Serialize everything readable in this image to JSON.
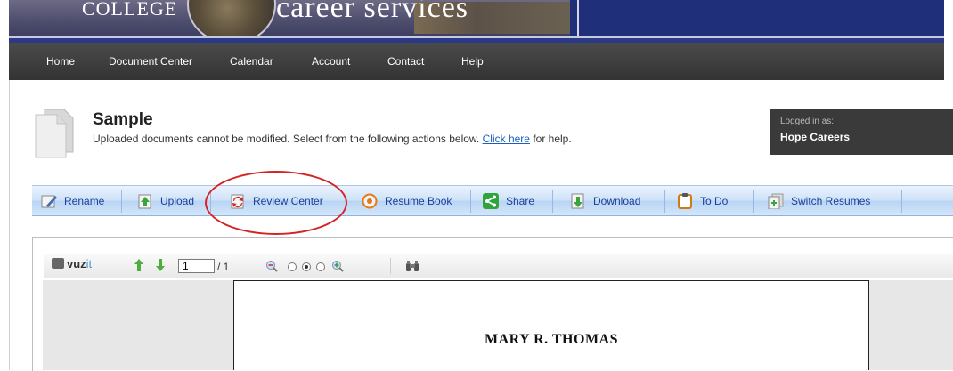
{
  "banner": {
    "college": "COLLEGE",
    "career": "career services"
  },
  "nav": {
    "items": [
      "Home",
      "Document Center",
      "Calendar",
      "Account",
      "Contact",
      "Help"
    ]
  },
  "header": {
    "title": "Sample",
    "subtitle_before": "Uploaded documents cannot be modified. Select from the following actions below.",
    "link": "Click here",
    "subtitle_after": "for help."
  },
  "login": {
    "label": "Logged in as:",
    "user": "Hope Careers"
  },
  "toolbar": {
    "items": [
      {
        "label": "Rename",
        "icon": "rename-icon"
      },
      {
        "label": "Upload",
        "icon": "upload-icon"
      },
      {
        "label": "Review Center",
        "icon": "review-icon"
      },
      {
        "label": "Resume Book",
        "icon": "resume-book-icon"
      },
      {
        "label": "Share",
        "icon": "share-icon"
      },
      {
        "label": "Download",
        "icon": "download-icon"
      },
      {
        "label": "To Do",
        "icon": "todo-icon"
      },
      {
        "label": "Switch Resumes",
        "icon": "switch-icon"
      }
    ]
  },
  "viewer": {
    "logo_bold": "vuz",
    "logo_it": "it",
    "page_value": "1",
    "page_total": "/ 1",
    "document_name": "MARY R. THOMAS"
  },
  "colors": {
    "nav_bg": "#3c3c3c",
    "toolbar_link": "#1a3f9a",
    "annotation": "#d42424",
    "banner": "#1f2f7a"
  }
}
